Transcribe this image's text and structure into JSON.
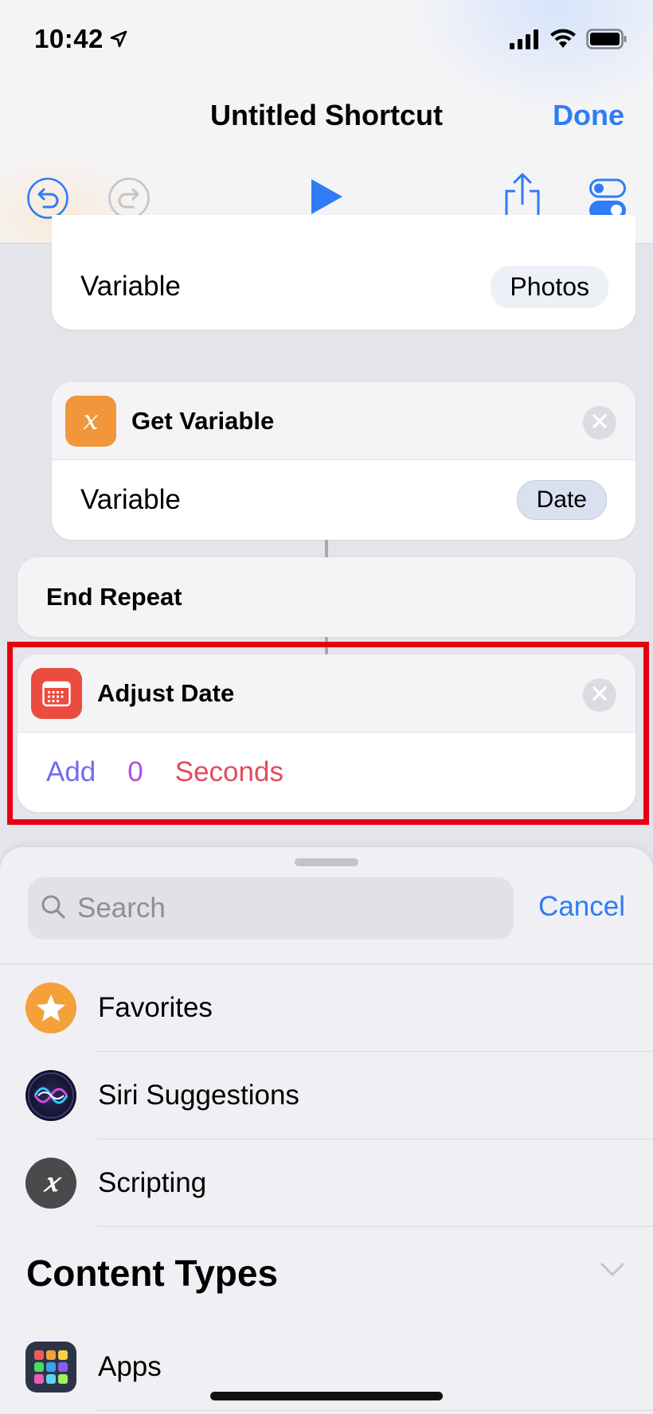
{
  "status_bar": {
    "time": "10:42"
  },
  "nav": {
    "title": "Untitled Shortcut",
    "done_label": "Done"
  },
  "cards": {
    "set_variable_partial": {
      "row_label": "Variable",
      "row_value": "Photos"
    },
    "get_variable": {
      "title": "Get Variable",
      "icon_glyph": "x",
      "icon_color": "#f1963a",
      "row_label": "Variable",
      "row_value": "Date"
    },
    "end_repeat": {
      "title": "End Repeat"
    },
    "adjust_date": {
      "title": "Adjust Date",
      "icon_color": "#ea4c3e",
      "operation": "Add",
      "amount": "0",
      "unit": "Seconds"
    }
  },
  "sheet": {
    "search_placeholder": "Search",
    "cancel_label": "Cancel",
    "items": [
      {
        "label": "Favorites",
        "icon": "star-icon",
        "color": "#f5a13a"
      },
      {
        "label": "Siri Suggestions",
        "icon": "siri-icon",
        "color": "#1b1b3a"
      },
      {
        "label": "Scripting",
        "icon": "script-x-icon",
        "color": "#4a4a4c"
      }
    ],
    "section_title": "Content Types",
    "section_items": [
      {
        "label": "Apps",
        "icon": "apps-grid-icon"
      }
    ]
  },
  "colors": {
    "accent": "#2f7cf6",
    "operation": "#6e6ef0",
    "amount": "#b34bd9",
    "unit": "#e44b5e",
    "highlight": "#e60012"
  }
}
